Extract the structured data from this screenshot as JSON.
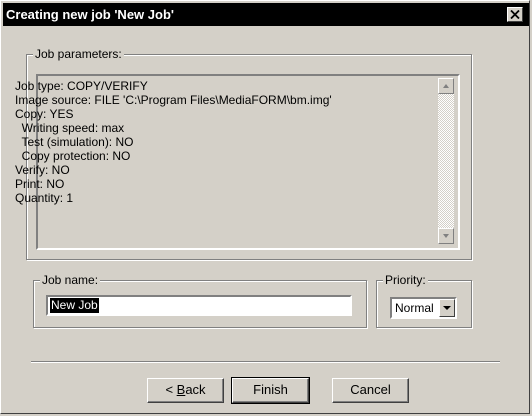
{
  "window": {
    "title": "Creating new job 'New Job'",
    "close_icon": "close-x"
  },
  "job_parameters": {
    "label": "Job parameters:",
    "lines": [
      "Job type: COPY/VERIFY",
      "Image source: FILE 'C:\\Program Files\\MediaFORM\\bm.img'",
      "Copy: YES",
      "  Writing speed: max",
      "  Test (simulation): NO",
      "  Copy protection: NO",
      "Verify: NO",
      "Print: NO",
      "Quantity: 1"
    ]
  },
  "job_name": {
    "label": "Job name:",
    "value": "New Job"
  },
  "priority": {
    "label": "Priority:",
    "selected": "Normal"
  },
  "buttons": {
    "back_prefix": "< ",
    "back_accel": "B",
    "back_rest": "ack",
    "finish": "Finish",
    "cancel": "Cancel"
  }
}
